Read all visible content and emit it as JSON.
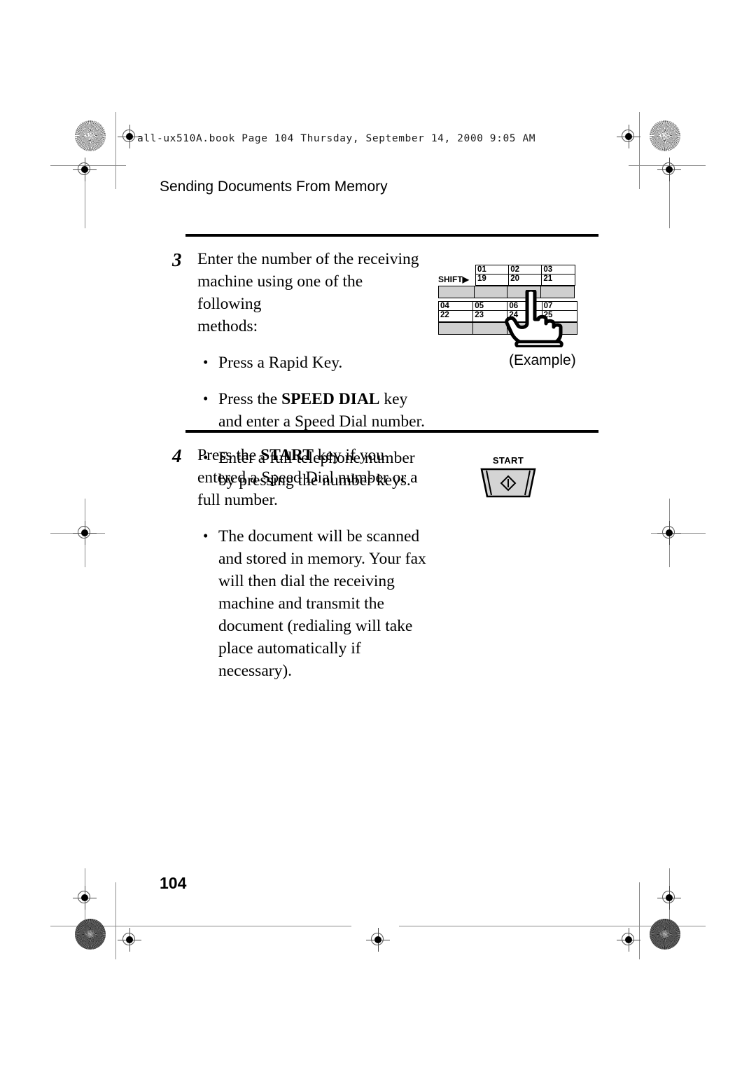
{
  "slug": {
    "text": "all-ux510A.book  Page 104  Thursday, September 14, 2000  9:05 AM"
  },
  "running_head": {
    "title": "Sending Documents From Memory"
  },
  "steps": [
    {
      "number": "3",
      "intro": [
        "Enter the number of the receiving",
        "machine using one of the following",
        "methods:"
      ],
      "bullets": [
        {
          "segments": [
            {
              "text": "Press a Rapid Key.",
              "bold": false
            }
          ]
        },
        {
          "segments": [
            {
              "text": "Press the ",
              "bold": false
            },
            {
              "text": "SPEED DIAL",
              "bold": true
            },
            {
              "text": " key and enter a Speed Dial number.",
              "bold": false
            }
          ]
        },
        {
          "segments": [
            {
              "text": "Enter a full telephone number by pressing the number keys.",
              "bold": false
            }
          ]
        }
      ]
    },
    {
      "number": "4",
      "intro_segments": [
        {
          "text": "Press the ",
          "bold": false
        },
        {
          "text": "START",
          "bold": true
        },
        {
          "text": " key if you entered a Speed Dial number or a full number.",
          "bold": false
        }
      ],
      "bullets": [
        {
          "segments": [
            {
              "text": "The document will be scanned and stored in memory. Your fax will then dial the receiving machine and transmit the document (redialing will take place automatically if necessary).",
              "bold": false
            }
          ]
        }
      ]
    }
  ],
  "rapid_key_figure": {
    "shift_label": "SHIFT",
    "shift_arrow": "▶",
    "row1_labels": [
      {
        "top": "01",
        "bottom": "19"
      },
      {
        "top": "02",
        "bottom": "20"
      },
      {
        "top": "03",
        "bottom": "21"
      }
    ],
    "row2_labels": [
      {
        "top": "04",
        "bottom": "22"
      },
      {
        "top": "05",
        "bottom": "23"
      },
      {
        "top": "06",
        "bottom": "24"
      },
      {
        "top": "07",
        "bottom": "25"
      }
    ],
    "key_fill_color": "#cfcfcf",
    "caption": "(Example)"
  },
  "start_key_figure": {
    "label": "START",
    "face_color": "#d4d4d4",
    "icon": "start-diamond-icon"
  },
  "folio": {
    "page_number": "104"
  }
}
